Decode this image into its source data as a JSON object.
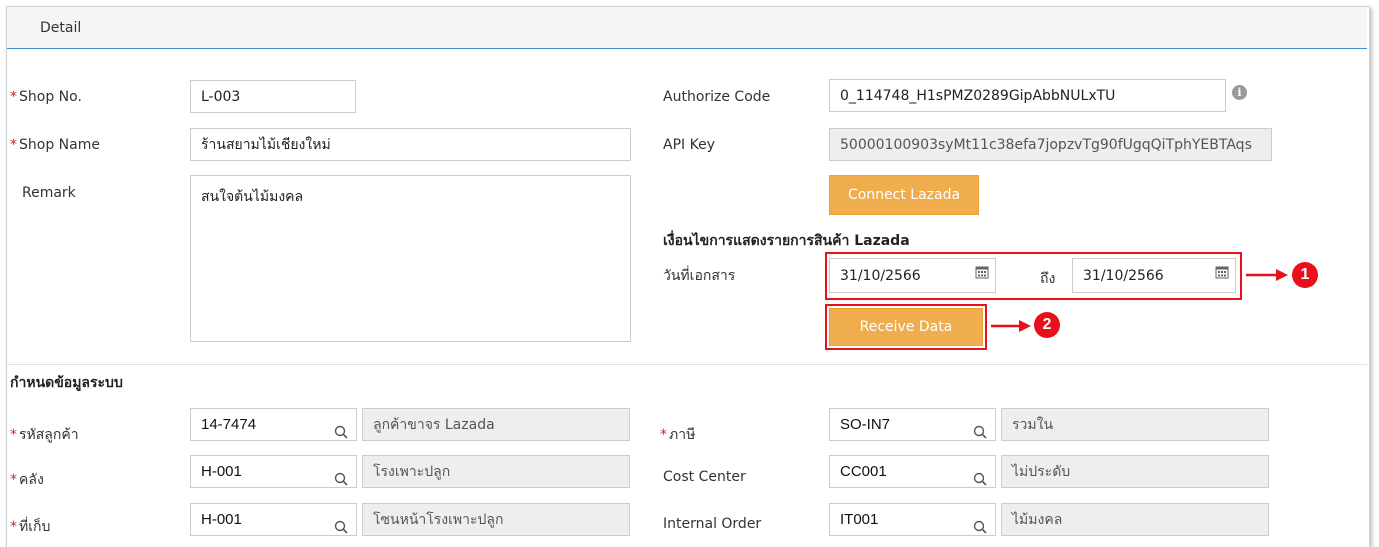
{
  "header": {
    "title": "Detail"
  },
  "shop": {
    "shop_no_label": "Shop No.",
    "shop_no_value": "L-003",
    "shop_name_label": "Shop Name",
    "shop_name_value": "ร้านสยามไม้เชียงใหม่",
    "remark_label": "Remark",
    "remark_value": "สนใจต้นไม้มงคล",
    "required_mark": "*"
  },
  "api": {
    "authorize_label": "Authorize Code",
    "authorize_value": "0_114748_H1sPMZ0289GipAbbNULxTU",
    "info_icon": "i",
    "apikey_label": "API Key",
    "apikey_value": "50000100903syMt11c38efa7jopzvTg90fUgqQiTphYEBTAqs",
    "connect_button": "Connect Lazada"
  },
  "filter": {
    "heading": "เงื่อนไขการแสดงรายการสินค้า Lazada",
    "date_label": "วันที่เอกสาร",
    "date_from": "31/10/2566",
    "to_label": "ถึง",
    "date_to": "31/10/2566",
    "receive_button": "Receive Data",
    "callout_1": "1",
    "callout_2": "2"
  },
  "system": {
    "title": "กำหนดข้อมูลระบบ",
    "rows": [
      {
        "left_label": "รหัสลูกค้า",
        "left_required": true,
        "left_code": "14-7474",
        "left_desc": "ลูกค้าขาจร Lazada",
        "right_label": "ภาษี",
        "right_required": true,
        "right_code": "SO-IN7",
        "right_desc": "รวมใน"
      },
      {
        "left_label": "คลัง",
        "left_required": true,
        "left_code": "H-001",
        "left_desc": "โรงเพาะปลูก",
        "right_label": "Cost Center",
        "right_required": false,
        "right_code": "CC001",
        "right_desc": "ไม่ประดับ"
      },
      {
        "left_label": "ที่เก็บ",
        "left_required": true,
        "left_code": "H-001",
        "left_desc": "โซนหน้าโรงเพาะปลูก",
        "right_label": "Internal Order",
        "right_required": false,
        "right_code": "IT001",
        "right_desc": "ไม้มงคล"
      }
    ]
  },
  "colors": {
    "accent_orange": "#f0ad4e",
    "callout_red": "#e8101a",
    "header_line": "#3d8fd1"
  }
}
